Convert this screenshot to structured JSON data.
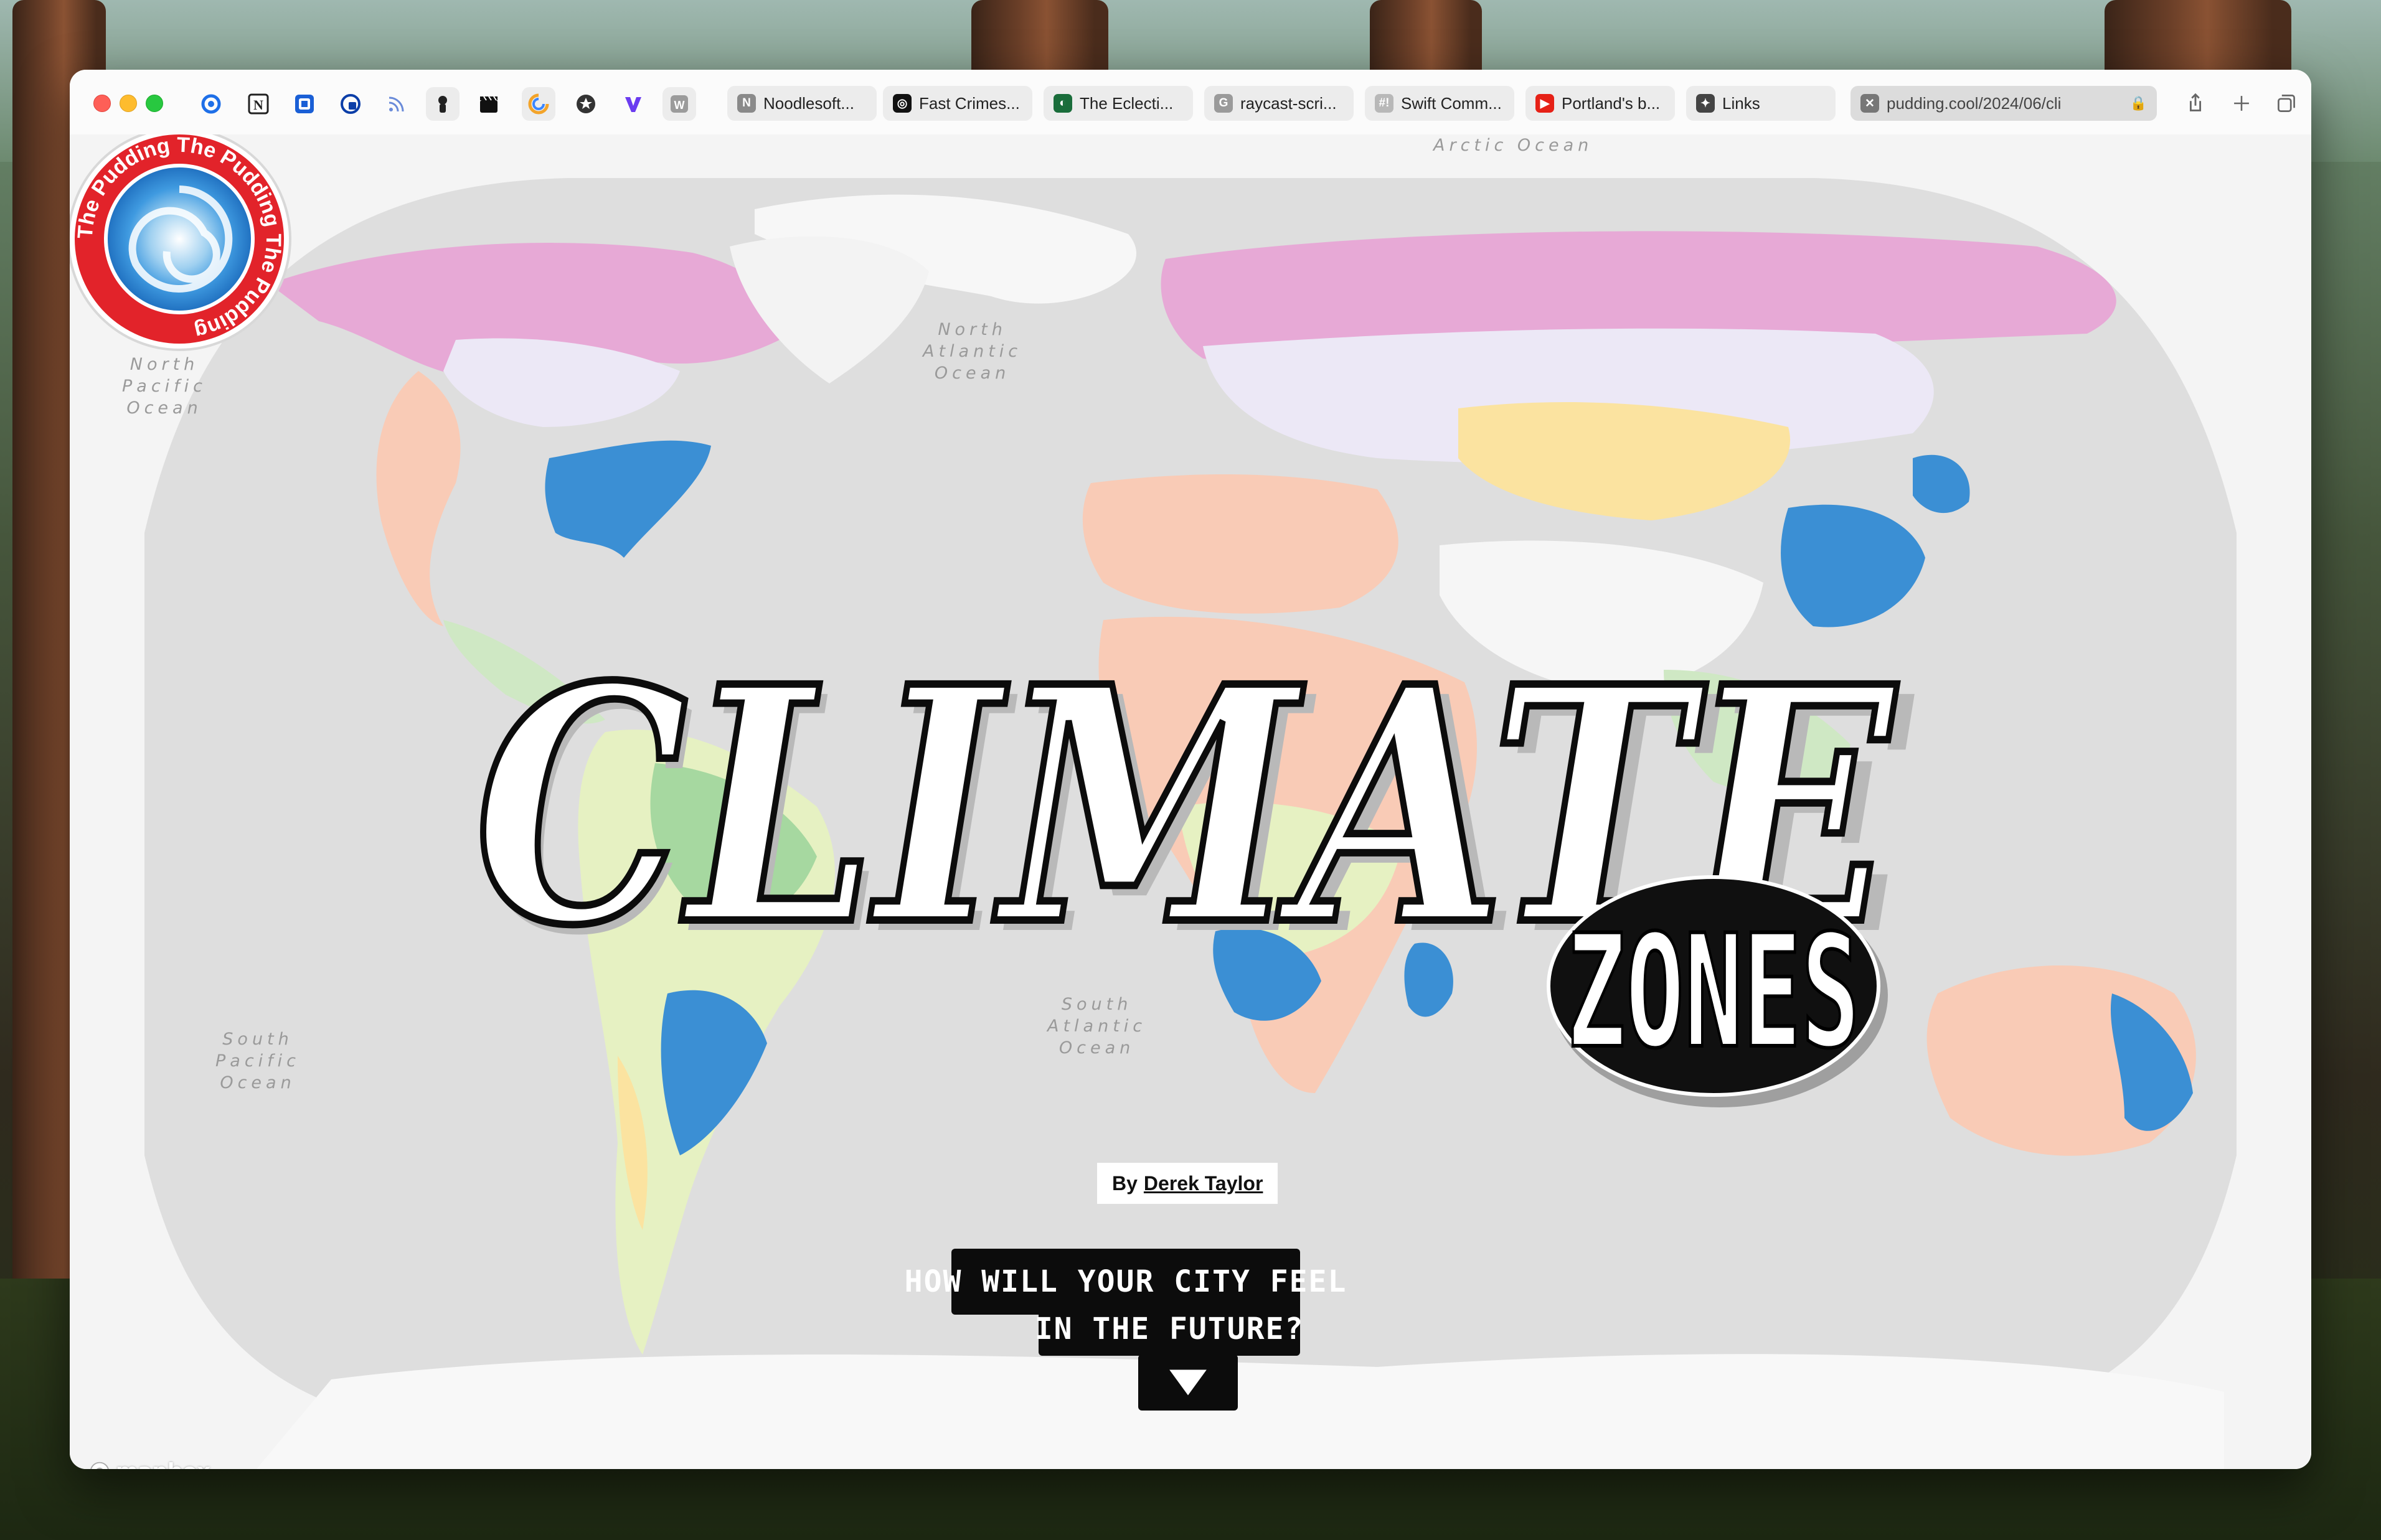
{
  "browser": {
    "pinned": [
      {
        "icon": "refresh-icon",
        "color": "#1e6fe8"
      },
      {
        "icon": "notion-icon",
        "color": "#ffffff"
      },
      {
        "icon": "bookmark-icon",
        "color": "#1a5fd6"
      },
      {
        "icon": "privacy-icon",
        "color": "#0b3ea8"
      },
      {
        "icon": "rss-icon",
        "color": "#6a8bd9"
      },
      {
        "icon": "mascot-icon",
        "color": "#e8e8e8"
      },
      {
        "icon": "clapper-icon",
        "color": "#111111"
      },
      {
        "icon": "spiral-icon",
        "color": "#f3a42a"
      },
      {
        "icon": "star-icon",
        "color": "#333333"
      },
      {
        "icon": "v-icon",
        "color": "#6b3cf0"
      },
      {
        "icon": "w-icon",
        "color": "#9b9b9b"
      }
    ],
    "tabs": [
      {
        "label": "Noodlesoft...",
        "fav": "N",
        "favColor": "#8a8a8a"
      },
      {
        "label": "Fast Crimes...",
        "fav": "◎",
        "favColor": "#111111"
      },
      {
        "label": "The Eclecti...",
        "fav": "◐",
        "favColor": "#1a6d3b"
      },
      {
        "label": "raycast-scri...",
        "fav": "G",
        "favColor": "#9a9a9a"
      },
      {
        "label": "Swift Comm...",
        "fav": "#!",
        "favColor": "#b8b8b8"
      },
      {
        "label": "Portland's b...",
        "fav": "▶",
        "favColor": "#e62117"
      },
      {
        "label": "Links",
        "fav": "✦",
        "favColor": "#444444"
      }
    ],
    "active_tab": {
      "url": "pudding.cool/2024/06/cli",
      "fav": "✕"
    }
  },
  "page": {
    "badge_text": "The Pudding The Pudding The Pudding ",
    "title": "CLIMATE",
    "subtitle": "ZONES",
    "byline_prefix": "By",
    "author": "Derek Taylor",
    "cta_line1": "HOW WILL YOUR CITY FEEL",
    "cta_line2": "IN THE FUTURE?",
    "attribution": "mapbox",
    "oceans": {
      "arctic": "Arctic Ocean",
      "north_atlantic": "North\nAtlantic\nOcean",
      "north_pacific": "North\nPacific\nOcean",
      "south_atlantic": "South\nAtlantic\nOcean",
      "south_pacific": "South\nPacific\nOcean"
    }
  }
}
